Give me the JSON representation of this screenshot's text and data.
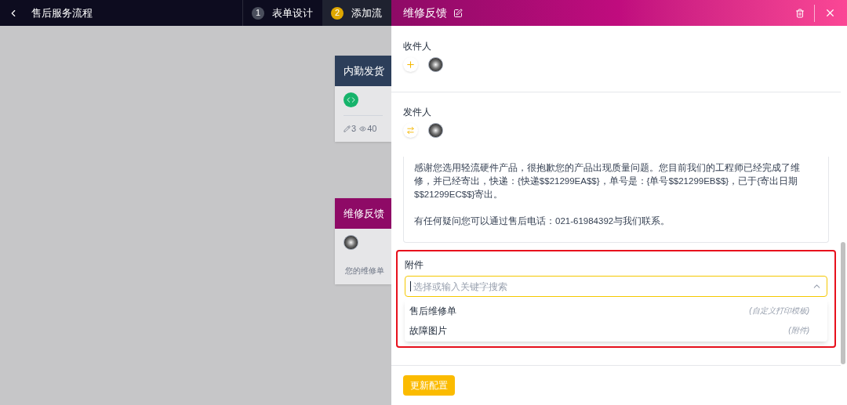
{
  "topbar": {
    "title": "售后服务流程"
  },
  "steps": [
    {
      "number": "1",
      "label": "表单设计",
      "selected": false
    },
    {
      "number": "2",
      "label": "添加流",
      "selected": true
    }
  ],
  "nodes": [
    {
      "kind": "stats",
      "title": "内勤发货",
      "color": "#2c3e5a",
      "stats": [
        {
          "kind": "edit",
          "value": "3"
        },
        {
          "kind": "view",
          "value": "40"
        }
      ]
    },
    {
      "kind": "message",
      "title": "维修反馈",
      "color": "#8e0a66",
      "note": "您的维修单"
    }
  ],
  "panel": {
    "title": "维修反馈",
    "recipients": {
      "label": "收件人"
    },
    "sender": {
      "label": "发件人"
    },
    "message": [
      "感谢您选用轻流硬件产品，很抱歉您的产品出现质量问题。您目前我们的工程师已经完成了维修，并已经寄出，快递：{快递$$21299EA$$}，单号是：{单号$$21299EB$$}，已于{寄出日期$$21299EC$$}寄出。",
      "有任何疑问您可以通过售后电话：021-61984392与我们联系。"
    ],
    "attachment": {
      "label": "附件",
      "placeholder": "选择或输入关键字搜索",
      "highlighted": true,
      "expanded": true,
      "options": [
        {
          "label": "售后维修单",
          "hint": "(自定义打印模板)"
        },
        {
          "label": "故障图片",
          "hint": "(附件)"
        }
      ]
    },
    "button": "更新配置"
  }
}
